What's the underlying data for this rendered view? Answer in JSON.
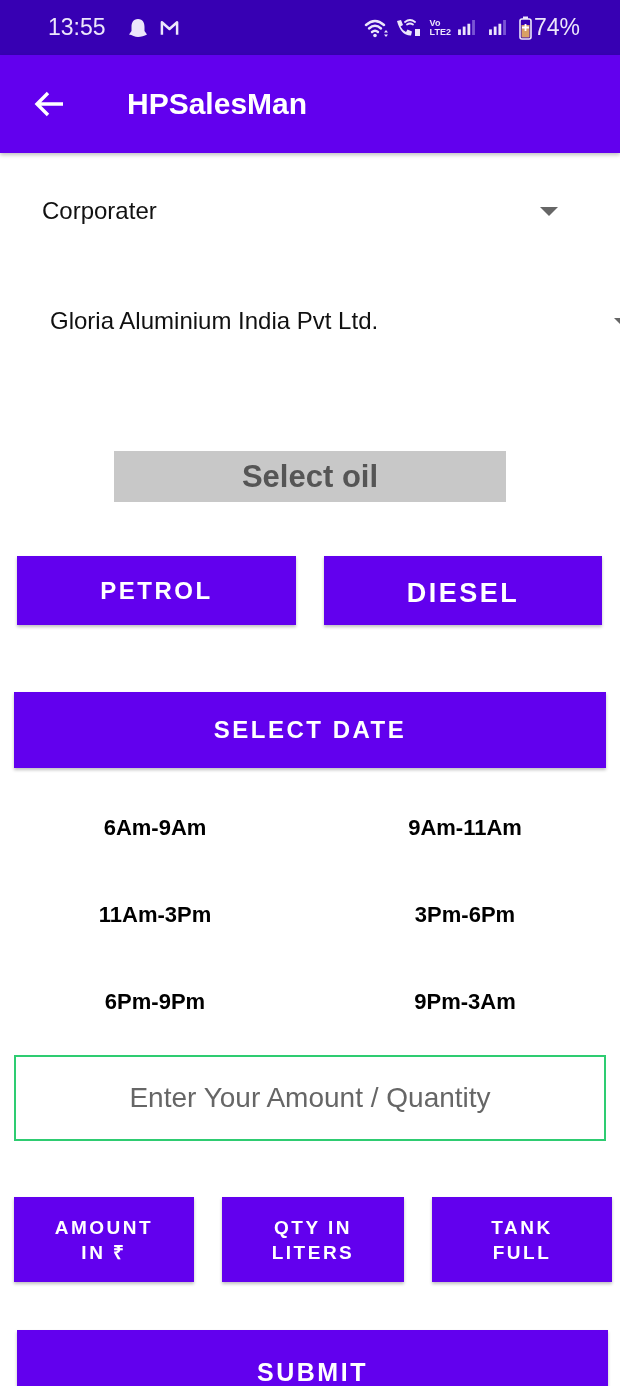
{
  "status_bar": {
    "time": "13:55",
    "network_label": [
      "Vo",
      "LTE2"
    ],
    "battery": "74%"
  },
  "app_bar": {
    "title": "HPSalesMan"
  },
  "spinners": [
    {
      "value": "Corporater"
    },
    {
      "value": "Gloria Aluminium India Pvt Ltd."
    }
  ],
  "oil_label": "Select oil",
  "oil_buttons": [
    "PETROL",
    "DIESEL"
  ],
  "date_button": "SELECT DATE",
  "time_slots": [
    "6Am-9Am",
    "9Am-11Am",
    "11Am-3Pm",
    "3Pm-6Pm",
    "6Pm-9Pm",
    "9Pm-3Am"
  ],
  "amount_field": {
    "placeholder": "Enter Your Amount / Quantity"
  },
  "unit_buttons": [
    "AMOUNT\nIN ₹",
    "QTY IN\nLITERS",
    "TANK\nFULL"
  ],
  "submit_button": "SUBMIT"
}
